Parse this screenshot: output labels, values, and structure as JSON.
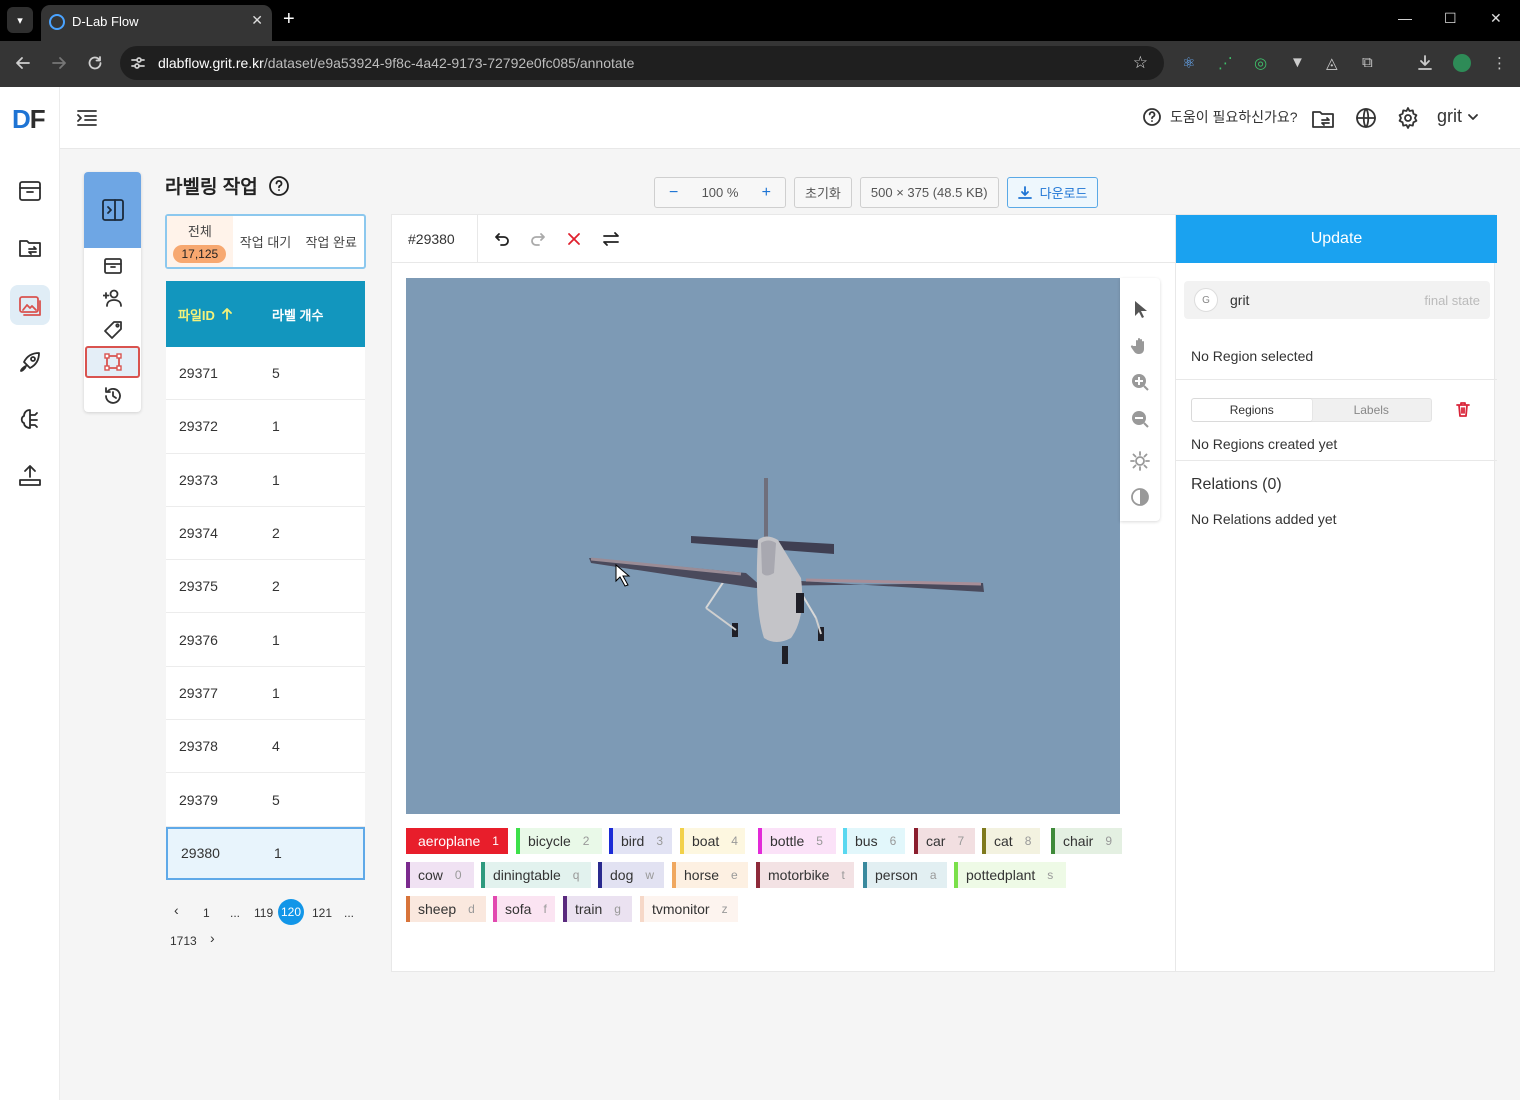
{
  "browser": {
    "tab_title": "D-Lab Flow",
    "url_domain": "dlabflow.grit.re.kr",
    "url_path": "/dataset/e9a53924-9f8c-4a42-9173-72792e0fc085/annotate",
    "window_controls": [
      "—",
      "☐",
      "✕"
    ]
  },
  "app": {
    "logo": {
      "d": "D",
      "f": "F"
    },
    "help_text": "도움이 필요하신가요?",
    "user": "grit",
    "accent": "#1aa2f0"
  },
  "labeling": {
    "title": "라벨링 작업",
    "tabs": [
      {
        "label": "전체",
        "count": "17,125"
      },
      {
        "label": "작업 대기"
      },
      {
        "label": "작업 완료"
      }
    ],
    "columns": {
      "file_id": "파일ID",
      "label_count": "라벨 개수"
    },
    "rows": [
      {
        "id": "29371",
        "count": "5"
      },
      {
        "id": "29372",
        "count": "1"
      },
      {
        "id": "29373",
        "count": "1"
      },
      {
        "id": "29374",
        "count": "2"
      },
      {
        "id": "29375",
        "count": "2"
      },
      {
        "id": "29376",
        "count": "1"
      },
      {
        "id": "29377",
        "count": "1"
      },
      {
        "id": "29378",
        "count": "4"
      },
      {
        "id": "29379",
        "count": "5"
      },
      {
        "id": "29380",
        "count": "1"
      }
    ],
    "pager": {
      "first": "1",
      "ellipsis": "...",
      "prev_page": "119",
      "current": "120",
      "next_page": "121",
      "last": "1713"
    }
  },
  "toolbar": {
    "zoom_minus": "−",
    "zoom": "100 %",
    "zoom_plus": "+",
    "reset": "초기화",
    "image_info": "500 × 375 (48.5 KB)",
    "download": "다운로드"
  },
  "annotator": {
    "image_id": "#29380",
    "labels": [
      {
        "name": "aeroplane",
        "key": "1",
        "color": "#e81e2b",
        "bg": "#e81e2b",
        "active": true
      },
      {
        "name": "bicycle",
        "key": "2",
        "color": "#3de04a",
        "bg": "#e9f9e8"
      },
      {
        "name": "bird",
        "key": "3",
        "color": "#1b2bd6",
        "bg": "#e2e3f4"
      },
      {
        "name": "boat",
        "key": "4",
        "color": "#f2d14a",
        "bg": "#fdf7e0"
      },
      {
        "name": "bottle",
        "key": "5",
        "color": "#e22ad8",
        "bg": "#fbe2f8"
      },
      {
        "name": "bus",
        "key": "6",
        "color": "#5ad8f0",
        "bg": "#e2f7fb"
      },
      {
        "name": "car",
        "key": "7",
        "color": "#8b1e2e",
        "bg": "#f2dfe1"
      },
      {
        "name": "cat",
        "key": "8",
        "color": "#7f7a1e",
        "bg": "#f3f2e0"
      },
      {
        "name": "chair",
        "key": "9",
        "color": "#3f8a3a",
        "bg": "#e4f0e2"
      },
      {
        "name": "cow",
        "key": "0",
        "color": "#7b2a8e",
        "bg": "#f0e2f3"
      },
      {
        "name": "diningtable",
        "key": "q",
        "color": "#2e9a7e",
        "bg": "#e2f2ee"
      },
      {
        "name": "dog",
        "key": "w",
        "color": "#2a2a8e",
        "bg": "#e2e2f2"
      },
      {
        "name": "horse",
        "key": "e",
        "color": "#f0a860",
        "bg": "#fdf0e2"
      },
      {
        "name": "motorbike",
        "key": "t",
        "color": "#8e2a3a",
        "bg": "#f3e2e4"
      },
      {
        "name": "person",
        "key": "a",
        "color": "#3a8a9e",
        "bg": "#e2eff2"
      },
      {
        "name": "pottedplant",
        "key": "s",
        "color": "#7ae04a",
        "bg": "#eefae6"
      },
      {
        "name": "sheep",
        "key": "d",
        "color": "#d8743a",
        "bg": "#fae8de"
      },
      {
        "name": "sofa",
        "key": "f",
        "color": "#e24ab0",
        "bg": "#fbe4f2"
      },
      {
        "name": "train",
        "key": "g",
        "color": "#5a2a7e",
        "bg": "#ebe2f1"
      },
      {
        "name": "tvmonitor",
        "key": "z",
        "color": "#f6d8c8",
        "bg": "#fdf4ef"
      }
    ]
  },
  "panel": {
    "update": "Update",
    "user": "grit",
    "user_initial": "G",
    "user_state": "final state",
    "no_region": "No Region selected",
    "tabs": [
      "Regions",
      "Labels"
    ],
    "no_regions": "No Regions created yet",
    "relations": "Relations (0)",
    "no_relations": "No Relations added yet"
  }
}
